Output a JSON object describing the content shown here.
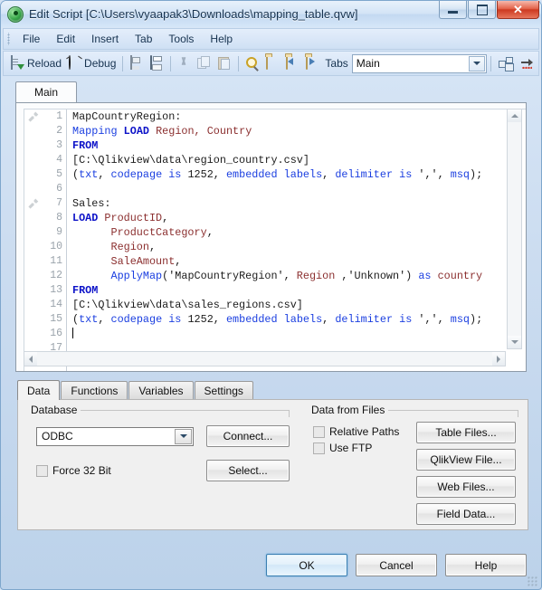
{
  "window": {
    "title": "Edit Script [C:\\Users\\vyaapak3\\Downloads\\mapping_table.qvw]",
    "app_icon": "qlikview-icon",
    "minimize_label": "Minimize",
    "maximize_label": "Maximize",
    "close_label": "✕"
  },
  "menu": {
    "items": [
      {
        "label": "File"
      },
      {
        "label": "Edit"
      },
      {
        "label": "Insert"
      },
      {
        "label": "Tab"
      },
      {
        "label": "Tools"
      },
      {
        "label": "Help"
      }
    ]
  },
  "toolbar": {
    "reload_label": "Reload",
    "reload_icon": "reload-icon",
    "debug_label": "Debug",
    "debug_icon": "bug-icon",
    "save_icon": "save-icon",
    "print_icon": "print-icon",
    "cut_icon": "scissors-icon",
    "copy_icon": "copy-icon",
    "paste_icon": "paste-icon",
    "search_icon": "magnifier-icon",
    "folder_icon": "folder-icon",
    "folder_back_icon": "folder-back-icon",
    "folder_forward_icon": "folder-forward-icon",
    "tabs_label": "Tabs",
    "tab_selected": "Main",
    "structure_icon": "table-structure-icon",
    "insert_icon": "insert-arrow-icon"
  },
  "script_tabs": [
    {
      "label": "Main",
      "active": true
    }
  ],
  "editor": {
    "marker_icon": "hammer-icon",
    "lines": [
      {
        "num": "1",
        "marker": true,
        "tokens": [
          {
            "t": "MapCountryRegion:",
            "c": "plain"
          }
        ]
      },
      {
        "num": "2",
        "marker": false,
        "tokens": [
          {
            "t": "Mapping",
            "c": "kw2"
          },
          {
            "t": " ",
            "c": "plain"
          },
          {
            "t": "LOAD",
            "c": "kw"
          },
          {
            "t": " ",
            "c": "plain"
          },
          {
            "t": "Region, Country",
            "c": "id"
          }
        ]
      },
      {
        "num": "3",
        "marker": false,
        "tokens": [
          {
            "t": "FROM",
            "c": "kw"
          }
        ]
      },
      {
        "num": "4",
        "marker": false,
        "tokens": [
          {
            "t": "[C:\\Qlikview\\data\\region_country.csv]",
            "c": "plain"
          }
        ]
      },
      {
        "num": "5",
        "marker": false,
        "tokens": [
          {
            "t": "(",
            "c": "plain"
          },
          {
            "t": "txt",
            "c": "kw2"
          },
          {
            "t": ", ",
            "c": "plain"
          },
          {
            "t": "codepage is",
            "c": "kw2"
          },
          {
            "t": " 1252, ",
            "c": "plain"
          },
          {
            "t": "embedded labels",
            "c": "kw2"
          },
          {
            "t": ", ",
            "c": "plain"
          },
          {
            "t": "delimiter is",
            "c": "kw2"
          },
          {
            "t": " ',', ",
            "c": "plain"
          },
          {
            "t": "msq",
            "c": "kw2"
          },
          {
            "t": ");",
            "c": "plain"
          }
        ]
      },
      {
        "num": "6",
        "marker": false,
        "tokens": [
          {
            "t": "",
            "c": "plain"
          }
        ]
      },
      {
        "num": "7",
        "marker": true,
        "tokens": [
          {
            "t": "Sales:",
            "c": "plain"
          }
        ]
      },
      {
        "num": "8",
        "marker": false,
        "tokens": [
          {
            "t": "LOAD",
            "c": "kw"
          },
          {
            "t": " ",
            "c": "plain"
          },
          {
            "t": "ProductID",
            "c": "id"
          },
          {
            "t": ",",
            "c": "plain"
          }
        ]
      },
      {
        "num": "9",
        "marker": false,
        "tokens": [
          {
            "t": "      ",
            "c": "plain"
          },
          {
            "t": "ProductCategory",
            "c": "id"
          },
          {
            "t": ",",
            "c": "plain"
          }
        ]
      },
      {
        "num": "10",
        "marker": false,
        "tokens": [
          {
            "t": "      ",
            "c": "plain"
          },
          {
            "t": "Region",
            "c": "id"
          },
          {
            "t": ",",
            "c": "plain"
          }
        ]
      },
      {
        "num": "11",
        "marker": false,
        "tokens": [
          {
            "t": "      ",
            "c": "plain"
          },
          {
            "t": "SaleAmount",
            "c": "id"
          },
          {
            "t": ",",
            "c": "plain"
          }
        ]
      },
      {
        "num": "12",
        "marker": false,
        "tokens": [
          {
            "t": "      ",
            "c": "plain"
          },
          {
            "t": "ApplyMap",
            "c": "fn"
          },
          {
            "t": "('MapCountryRegion', ",
            "c": "plain"
          },
          {
            "t": "Region",
            "c": "id"
          },
          {
            "t": " ,'Unknown') ",
            "c": "plain"
          },
          {
            "t": "as",
            "c": "kw2"
          },
          {
            "t": " ",
            "c": "plain"
          },
          {
            "t": "country",
            "c": "id"
          }
        ]
      },
      {
        "num": "13",
        "marker": false,
        "tokens": [
          {
            "t": "FROM",
            "c": "kw"
          }
        ]
      },
      {
        "num": "14",
        "marker": false,
        "tokens": [
          {
            "t": "[C:\\Qlikview\\data\\sales_regions.csv]",
            "c": "plain"
          }
        ]
      },
      {
        "num": "15",
        "marker": false,
        "tokens": [
          {
            "t": "(",
            "c": "plain"
          },
          {
            "t": "txt",
            "c": "kw2"
          },
          {
            "t": ", ",
            "c": "plain"
          },
          {
            "t": "codepage is",
            "c": "kw2"
          },
          {
            "t": " 1252, ",
            "c": "plain"
          },
          {
            "t": "embedded labels",
            "c": "kw2"
          },
          {
            "t": ", ",
            "c": "plain"
          },
          {
            "t": "delimiter is",
            "c": "kw2"
          },
          {
            "t": " ',', ",
            "c": "plain"
          },
          {
            "t": "msq",
            "c": "kw2"
          },
          {
            "t": ");",
            "c": "plain"
          }
        ]
      },
      {
        "num": "16",
        "marker": false,
        "cursor": true,
        "tokens": [
          {
            "t": "",
            "c": "plain"
          }
        ]
      },
      {
        "num": "17",
        "marker": false,
        "tokens": [
          {
            "t": "",
            "c": "plain"
          }
        ]
      }
    ]
  },
  "bottom_tabs": [
    {
      "label": "Data",
      "active": true
    },
    {
      "label": "Functions",
      "active": false
    },
    {
      "label": "Variables",
      "active": false
    },
    {
      "label": "Settings",
      "active": false
    }
  ],
  "database": {
    "group_label": "Database",
    "source_selected": "ODBC",
    "connect_label": "Connect...",
    "select_label": "Select...",
    "force32_label": "Force 32 Bit",
    "force32_checked": false
  },
  "data_from_files": {
    "group_label": "Data from Files",
    "relative_paths_label": "Relative Paths",
    "relative_paths_checked": false,
    "use_ftp_label": "Use FTP",
    "use_ftp_checked": false,
    "table_files_label": "Table Files...",
    "qlikview_file_label": "QlikView File...",
    "web_files_label": "Web Files...",
    "field_data_label": "Field Data..."
  },
  "footer": {
    "ok_label": "OK",
    "cancel_label": "Cancel",
    "help_label": "Help"
  },
  "colors": {
    "keyword": "#0c12c8",
    "keyword_alt": "#1a3ee0",
    "identifier": "#8b2f2f",
    "accent": "#3c7fb1",
    "close_red": "#cc3a21"
  }
}
